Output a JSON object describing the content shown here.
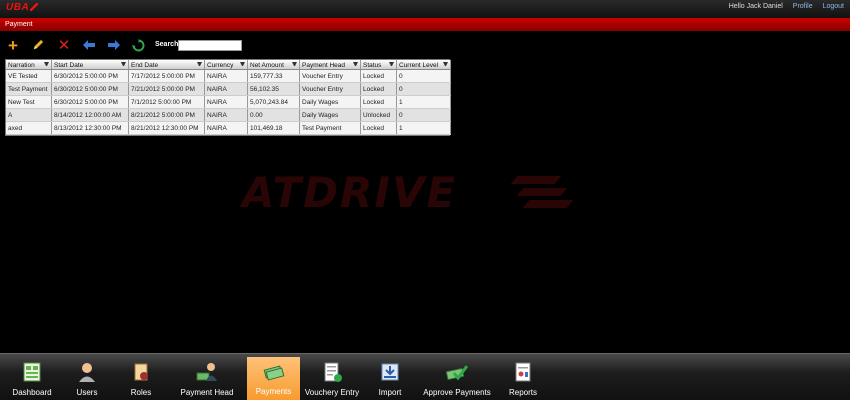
{
  "header": {
    "logo": "UBA",
    "greeting": "Hello Jack Daniel",
    "profile_link": "Profile",
    "logout_link": "Logout"
  },
  "breadcrumb": {
    "title": "Payment"
  },
  "toolbar": {
    "search_label": "Search",
    "search_value": "",
    "icons": [
      "add-icon",
      "edit-icon",
      "delete-icon",
      "back-arrow-icon",
      "forward-arrow-icon",
      "refresh-icon"
    ]
  },
  "grid": {
    "columns": [
      "Narration",
      "Start Date",
      "End Date",
      "Currency",
      "Net Amount",
      "Payment Head",
      "Status",
      "Current Level"
    ],
    "rows": [
      [
        "VE Tested",
        "6/30/2012 5:00:00 PM",
        "7/17/2012 5:00:00 PM",
        "NAIRA",
        "159,777.33",
        "Voucher Entry",
        "Locked",
        "0"
      ],
      [
        "Test Payment",
        "6/30/2012 5:00:00 PM",
        "7/21/2012 5:00:00 PM",
        "NAIRA",
        "56,102.35",
        "Voucher Entry",
        "Locked",
        "0"
      ],
      [
        "New Test",
        "6/30/2012 5:00:00 PM",
        "7/1/2012 5:00:00 PM",
        "NAIRA",
        "5,070,243.84",
        "Daily Wages",
        "Locked",
        "1"
      ],
      [
        "A",
        "8/14/2012 12:00:00 AM",
        "8/21/2012 5:00:00 PM",
        "NAIRA",
        "0.00",
        "Daily Wages",
        "Unlocked",
        "0"
      ],
      [
        "axed",
        "8/13/2012 12:30:00 PM",
        "8/21/2012 12:30:00 PM",
        "NAIRA",
        "101,469.18",
        "Test Payment",
        "Locked",
        "1"
      ]
    ]
  },
  "watermark": {
    "text": "ATDRIVE"
  },
  "dock": {
    "items": [
      {
        "label": "Dashboard",
        "icon": "dashboard-icon"
      },
      {
        "label": "Users",
        "icon": "users-icon"
      },
      {
        "label": "Roles",
        "icon": "roles-icon"
      },
      {
        "label": "Payment Head",
        "icon": "payment-head-icon"
      },
      {
        "label": "Payments",
        "icon": "payments-icon"
      },
      {
        "label": "Vouchery Entry",
        "icon": "voucher-entry-icon"
      },
      {
        "label": "Import",
        "icon": "import-icon"
      },
      {
        "label": "Approve Payments",
        "icon": "approve-payments-icon"
      },
      {
        "label": "Reports",
        "icon": "reports-icon"
      }
    ],
    "active": "Payments"
  },
  "colors": {
    "accent_red": "#cc0000",
    "active_tab": "#f79a2c"
  }
}
